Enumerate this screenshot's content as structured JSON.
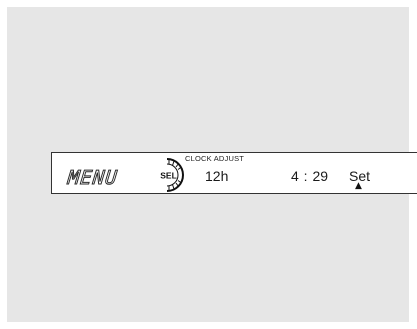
{
  "display": {
    "mode_label": "MENU",
    "title": "CLOCK ADJUST",
    "selector": {
      "label": "SEL",
      "icon": "selector-dial-icon"
    },
    "hour_format": "12h",
    "time": "4 : 29",
    "action": "Set",
    "action_indicator_icon": "up-triangle-icon"
  },
  "colors": {
    "background": "#e6e6e6",
    "lcd_panel": "#ffffff",
    "text": "#1a1a1a"
  }
}
